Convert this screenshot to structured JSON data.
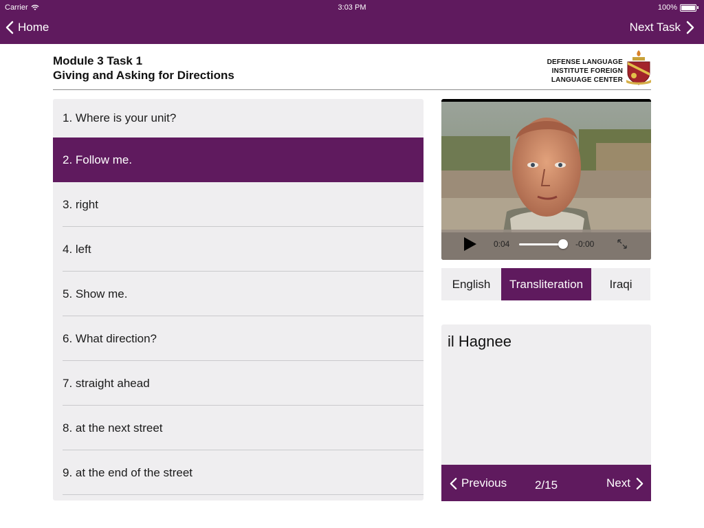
{
  "status_bar": {
    "carrier": "Carrier",
    "time": "3:03 PM",
    "battery": "100%"
  },
  "nav": {
    "back_label": "Home",
    "next_label": "Next Task"
  },
  "header": {
    "module": "Module 3 Task 1",
    "subtitle": "Giving and Asking for Directions",
    "logo_lines": [
      "DEFENSE LANGUAGE",
      "INSTITUTE FOREIGN",
      "LANGUAGE CENTER"
    ]
  },
  "phrases": [
    "1. Where is your unit?",
    "2. Follow me.",
    "3. right",
    "4. left",
    "5. Show me.",
    "6. What direction?",
    "7. straight ahead",
    "8. at the next street",
    "9. at the end of the street"
  ],
  "selected_index": 1,
  "video": {
    "elapsed": "0:04",
    "remaining": "-0:00",
    "progress": 1.0
  },
  "tabs": {
    "english": "English",
    "transliteration": "Transliteration",
    "iraqi": "Iraqi",
    "selected": "transliteration"
  },
  "translation_text": "il Hagnee",
  "pager": {
    "previous_label": "Previous",
    "count": "2/15",
    "next_label": "Next"
  },
  "colors": {
    "accent": "#5f1a5e",
    "panel_bg": "#efeef0"
  },
  "icons": [
    "wifi-icon",
    "battery-icon",
    "chevron-left-icon",
    "chevron-right-icon",
    "play-icon",
    "fullscreen-icon",
    "crest-icon"
  ]
}
